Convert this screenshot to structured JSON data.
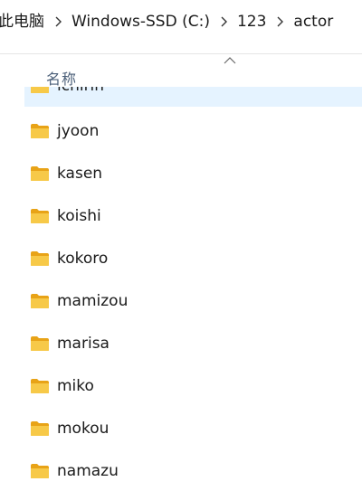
{
  "breadcrumb": {
    "items": [
      "此电脑",
      "Windows-SSD (C:)",
      "123",
      "actor"
    ]
  },
  "column_header": {
    "name_label": "名称",
    "sort": "ascending"
  },
  "folder_icon_color": "#f7c948",
  "selected_row_color": "#e5f3ff",
  "files": [
    {
      "name": "ichirin",
      "type": "folder"
    },
    {
      "name": "jyoon",
      "type": "folder"
    },
    {
      "name": "kasen",
      "type": "folder"
    },
    {
      "name": "koishi",
      "type": "folder"
    },
    {
      "name": "kokoro",
      "type": "folder"
    },
    {
      "name": "mamizou",
      "type": "folder"
    },
    {
      "name": "marisa",
      "type": "folder"
    },
    {
      "name": "miko",
      "type": "folder"
    },
    {
      "name": "mokou",
      "type": "folder"
    },
    {
      "name": "namazu",
      "type": "folder"
    }
  ]
}
